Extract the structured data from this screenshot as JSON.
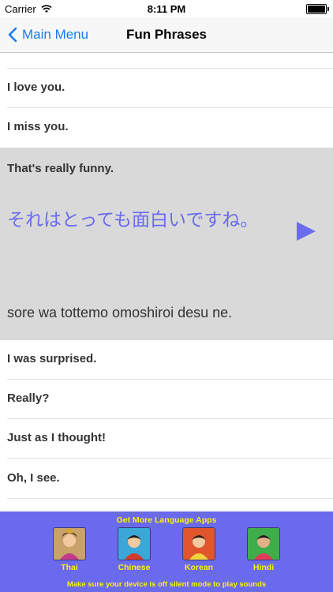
{
  "status_bar": {
    "carrier": "Carrier",
    "time": "8:11 PM"
  },
  "nav": {
    "back_label": "Main Menu",
    "title": "Fun Phrases"
  },
  "rows_above": [
    "I love you.",
    "I miss you."
  ],
  "expanded": {
    "english": "That's really funny.",
    "japanese": "それはとっても面白いですね。",
    "romaji": "sore wa tottemo omoshiroi desu ne."
  },
  "rows_below": [
    "I was surprised.",
    "Really?",
    "Just as I thought!",
    "Oh, I see."
  ],
  "banner": {
    "heading": "Get More Language Apps",
    "apps": [
      {
        "label": "Thai",
        "bg": "#c9a26a"
      },
      {
        "label": "Chinese",
        "bg": "#3aa7d8"
      },
      {
        "label": "Korean",
        "bg": "#e0552b"
      },
      {
        "label": "Hindi",
        "bg": "#3fae4a"
      }
    ],
    "footer": "Make sure your device is off silent mode to play sounds"
  },
  "colors": {
    "accent": "#1a7cf0",
    "japanese_text": "#6b6bf0",
    "banner_bg": "#6a6aee",
    "banner_text": "#fff200"
  }
}
